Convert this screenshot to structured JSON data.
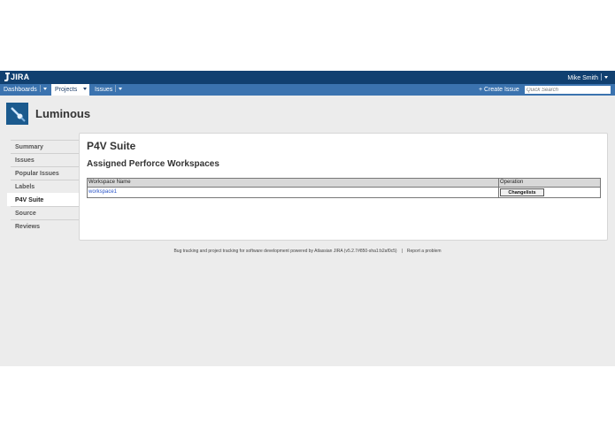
{
  "topbar": {
    "logo": "JIRA",
    "user": "Mike Smith"
  },
  "nav": {
    "dashboards": "Dashboards",
    "projects": "Projects",
    "issues": "Issues",
    "create_issue": "+ Create Issue",
    "quick_search_placeholder": "Quick Search"
  },
  "project": {
    "name": "Luminous"
  },
  "sidebar": {
    "items": [
      {
        "label": "Summary"
      },
      {
        "label": "Issues"
      },
      {
        "label": "Popular Issues"
      },
      {
        "label": "Labels"
      },
      {
        "label": "P4V Suite"
      },
      {
        "label": "Source"
      },
      {
        "label": "Reviews"
      }
    ]
  },
  "panel": {
    "title": "P4V Suite",
    "subtitle": "Assigned Perforce Workspaces",
    "table": {
      "columns": [
        "Workspace Name",
        "Operation"
      ],
      "rows": [
        {
          "workspace": "workspace1",
          "operation": "Changelists"
        }
      ]
    }
  },
  "footer": {
    "text": "Bug tracking and project tracking for software development powered by Atlassian JIRA (v5.2.7#850-sha1:b2af0c5)",
    "separator": "|",
    "report": "Report a problem"
  },
  "colors": {
    "topbar": "#114070",
    "navbar": "#3b73af",
    "link": "#2a55c8",
    "background": "#ececec"
  }
}
